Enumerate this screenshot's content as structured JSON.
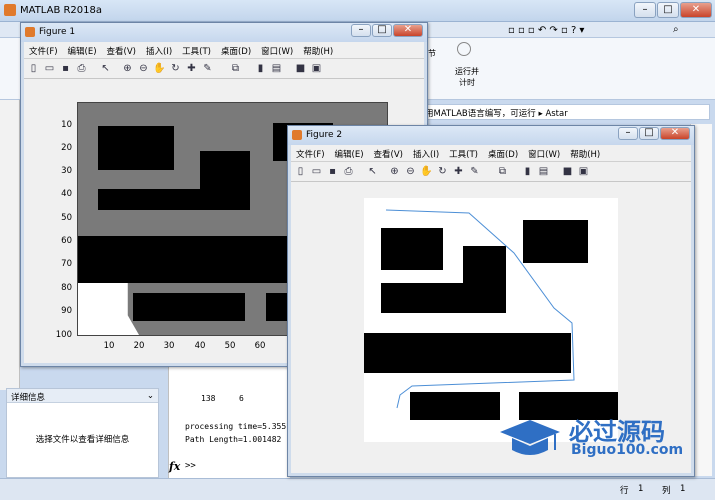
{
  "app": {
    "title": "MATLAB R2018a",
    "search_placeholder": "搜索文档"
  },
  "ribbon": {
    "btn_run_section": "行节",
    "btn_run_advance": "运行并\n计时"
  },
  "address": {
    "path_fragment": "用MATLAB语言编写，可运行",
    "crumb": "Astar"
  },
  "detail_panel": {
    "title": "详细信息",
    "body": "选择文件以查看详细信息"
  },
  "command": {
    "row": [
      "138",
      "6"
    ],
    "line1": "processing time=5.355",
    "line2": "Path Length=1.001482",
    "prompt": ">>"
  },
  "status": {
    "row_label": "行",
    "row_val": "1",
    "col_label": "列",
    "col_val": "1"
  },
  "figure1": {
    "title": "Figure 1",
    "menu": [
      "文件(F)",
      "编辑(E)",
      "查看(V)",
      "插入(I)",
      "工具(T)",
      "桌面(D)",
      "窗口(W)",
      "帮助(H)"
    ],
    "yticks": [
      "10",
      "20",
      "30",
      "40",
      "50",
      "60",
      "70",
      "80",
      "90",
      "100"
    ],
    "xticks": [
      "10",
      "20",
      "30",
      "40",
      "50",
      "60"
    ]
  },
  "figure2": {
    "title": "Figure 2",
    "menu": [
      "文件(F)",
      "编辑(E)",
      "查看(V)",
      "插入(I)",
      "工具(T)",
      "桌面(D)",
      "窗口(W)",
      "帮助(H)"
    ]
  },
  "watermark": {
    "cn": "必过源码",
    "en": "Biguo100.com"
  },
  "colors": {
    "path": "#4d8fd6",
    "obstacle": "#000000",
    "inflation": "#7a7a7a"
  }
}
